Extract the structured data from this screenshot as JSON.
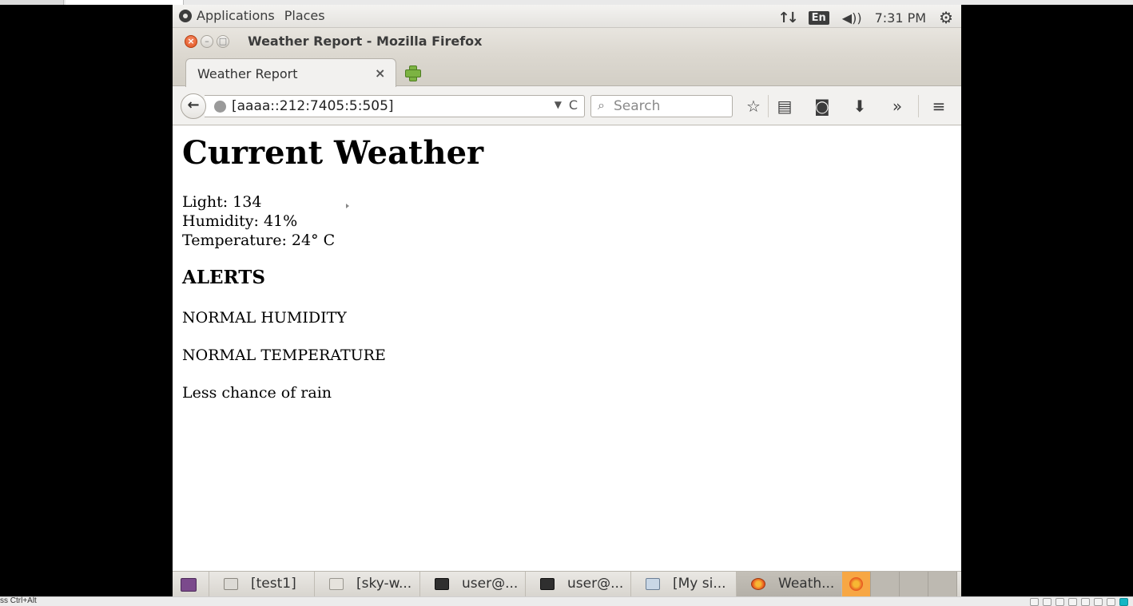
{
  "host": {
    "status_hint": "ss Ctrl+Alt"
  },
  "panel": {
    "applications": "Applications",
    "places": "Places",
    "keyboard_layout": "En",
    "clock": "7:31 PM",
    "icons": [
      "network-icon",
      "volume-icon",
      "settings-gear-icon"
    ]
  },
  "window": {
    "title": "Weather Report - Mozilla Firefox"
  },
  "tab": {
    "label": "Weather Report",
    "close": "×"
  },
  "navbar": {
    "url": "[aaaa::212:7405:5:505]",
    "search_placeholder": "Search",
    "overflow": "»"
  },
  "page": {
    "heading": "Current Weather",
    "readings": [
      "Light: 134",
      "Humidity: 41%",
      "Temperature: 24° C"
    ],
    "alerts_heading": "ALERTS",
    "alerts": [
      "NORMAL HUMIDITY",
      "NORMAL TEMPERATURE",
      "Less chance of rain"
    ]
  },
  "taskbar": {
    "items": [
      {
        "label": "[test1]",
        "icon": "file-manager-icon"
      },
      {
        "label": "[sky-w...",
        "icon": "text-editor-icon"
      },
      {
        "label": "user@...",
        "icon": "terminal-icon"
      },
      {
        "label": "user@...",
        "icon": "terminal-icon"
      },
      {
        "label": "[My si...",
        "icon": "network-icon"
      },
      {
        "label": "Weath...",
        "icon": "firefox-icon"
      }
    ]
  },
  "colors": {
    "close_button": "#e25420",
    "active_workspace": "#f7a744"
  }
}
